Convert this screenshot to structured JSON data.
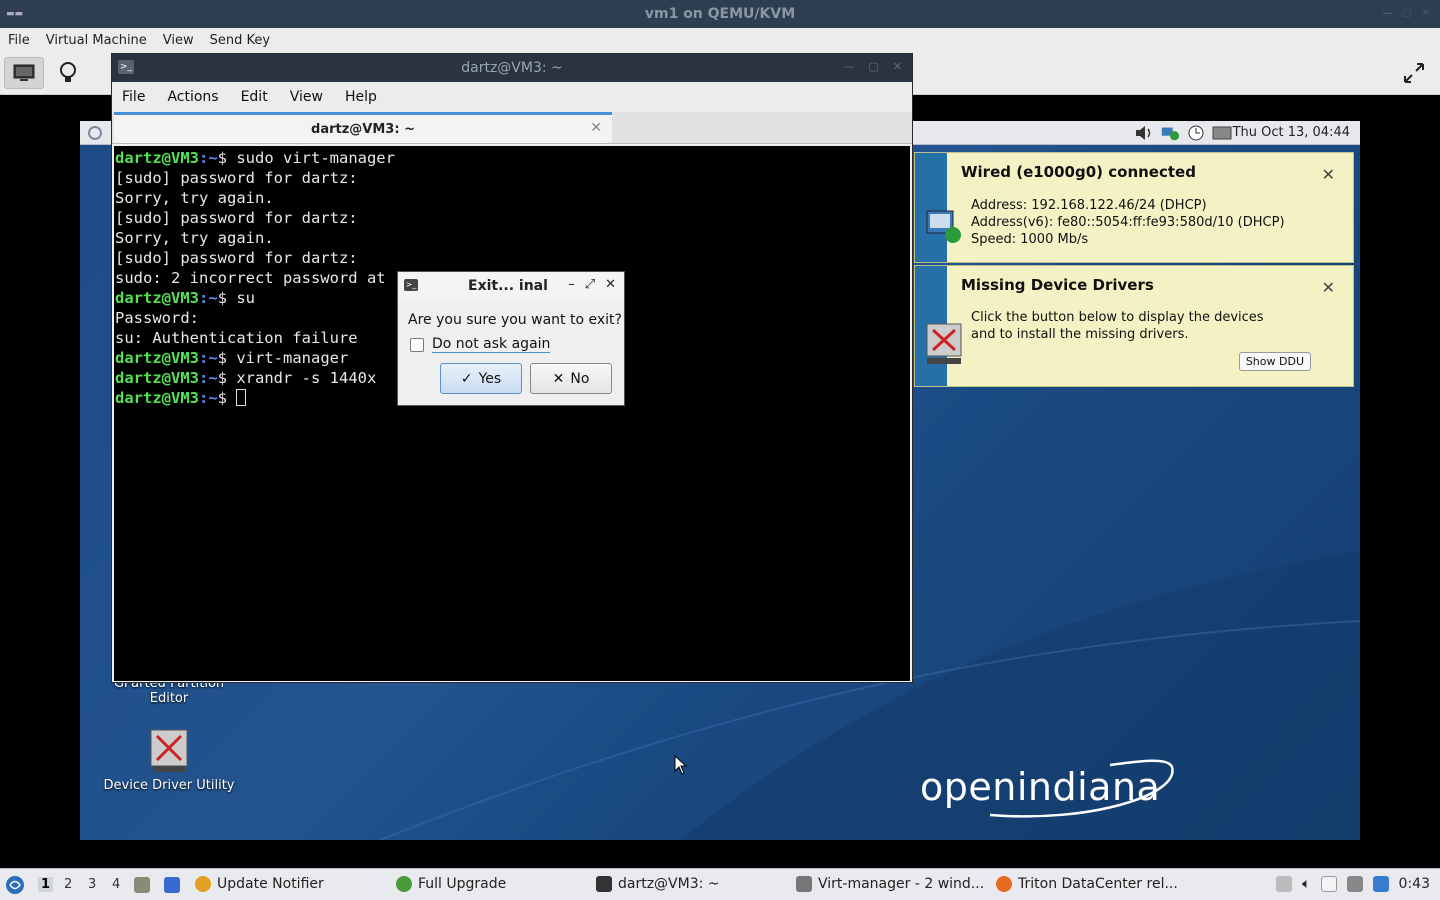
{
  "host": {
    "window_title": "vm1 on QEMU/KVM",
    "menu": [
      "File",
      "Virtual Machine",
      "View",
      "Send Key"
    ]
  },
  "guest": {
    "clock": "Thu Oct 13, 04:44",
    "desktop_icons": [
      {
        "label": "GParted Partition Editor"
      },
      {
        "label": "Device Driver Utility"
      }
    ],
    "logo_text": "openindiana"
  },
  "notifications": {
    "wired": {
      "title": "Wired (e1000g0) connected",
      "lines": [
        "Address: 192.168.122.46/24 (DHCP)",
        "Address(v6): fe80::5054:ff:fe93:580d/10 (DHCP)",
        "Speed: 1000 Mb/s"
      ]
    },
    "drivers": {
      "title": "Missing Device Drivers",
      "lines": [
        "Click the button below to display the devices",
        "and to install the missing drivers."
      ],
      "button_label": "Show DDU"
    }
  },
  "terminal": {
    "window_title": "dartz@VM3: ~",
    "menu": [
      "File",
      "Actions",
      "Edit",
      "View",
      "Help"
    ],
    "tab_label": "dartz@VM3: ~",
    "lines": [
      {
        "user": "dartz@VM3",
        "path": ":~",
        "text": "$ sudo virt-manager"
      },
      {
        "text": "[sudo] password for dartz:"
      },
      {
        "text": "Sorry, try again."
      },
      {
        "text": "[sudo] password for dartz:"
      },
      {
        "text": "Sorry, try again."
      },
      {
        "text": "[sudo] password for dartz:"
      },
      {
        "text": "sudo: 2 incorrect password at"
      },
      {
        "user": "dartz@VM3",
        "path": ":~",
        "text": "$ su"
      },
      {
        "text": "Password:"
      },
      {
        "text": "su: Authentication failure"
      },
      {
        "user": "dartz@VM3",
        "path": ":~",
        "text": "$ virt-manager"
      },
      {
        "user": "dartz@VM3",
        "path": ":~",
        "text": "$ xrandr -s 1440x"
      },
      {
        "user": "dartz@VM3",
        "path": ":~",
        "text": "$ ",
        "cursor": true
      }
    ]
  },
  "dialog": {
    "title": "Exit... inal",
    "question": "Are you sure you want to exit?",
    "checkbox_label": "Do not ask again",
    "checkbox_checked": false,
    "yes_label": "Yes",
    "no_label": "No"
  },
  "taskbar": {
    "workspaces": [
      "1",
      "2",
      "3",
      "4"
    ],
    "active_workspace": "1",
    "tasks": [
      {
        "label": "Update Notifier"
      },
      {
        "label": "Full Upgrade"
      },
      {
        "label": "dartz@VM3: ~"
      },
      {
        "label": "Virt-manager - 2 wind..."
      },
      {
        "label": "Triton DataCenter rel..."
      }
    ],
    "time": "0:43"
  },
  "colors": {
    "accent": "#4a90d9",
    "prompt_user": "#55e055",
    "prompt_path": "#5b8cff",
    "desktop": "#1e4b86",
    "notification_bg": "#f4f2c4"
  }
}
